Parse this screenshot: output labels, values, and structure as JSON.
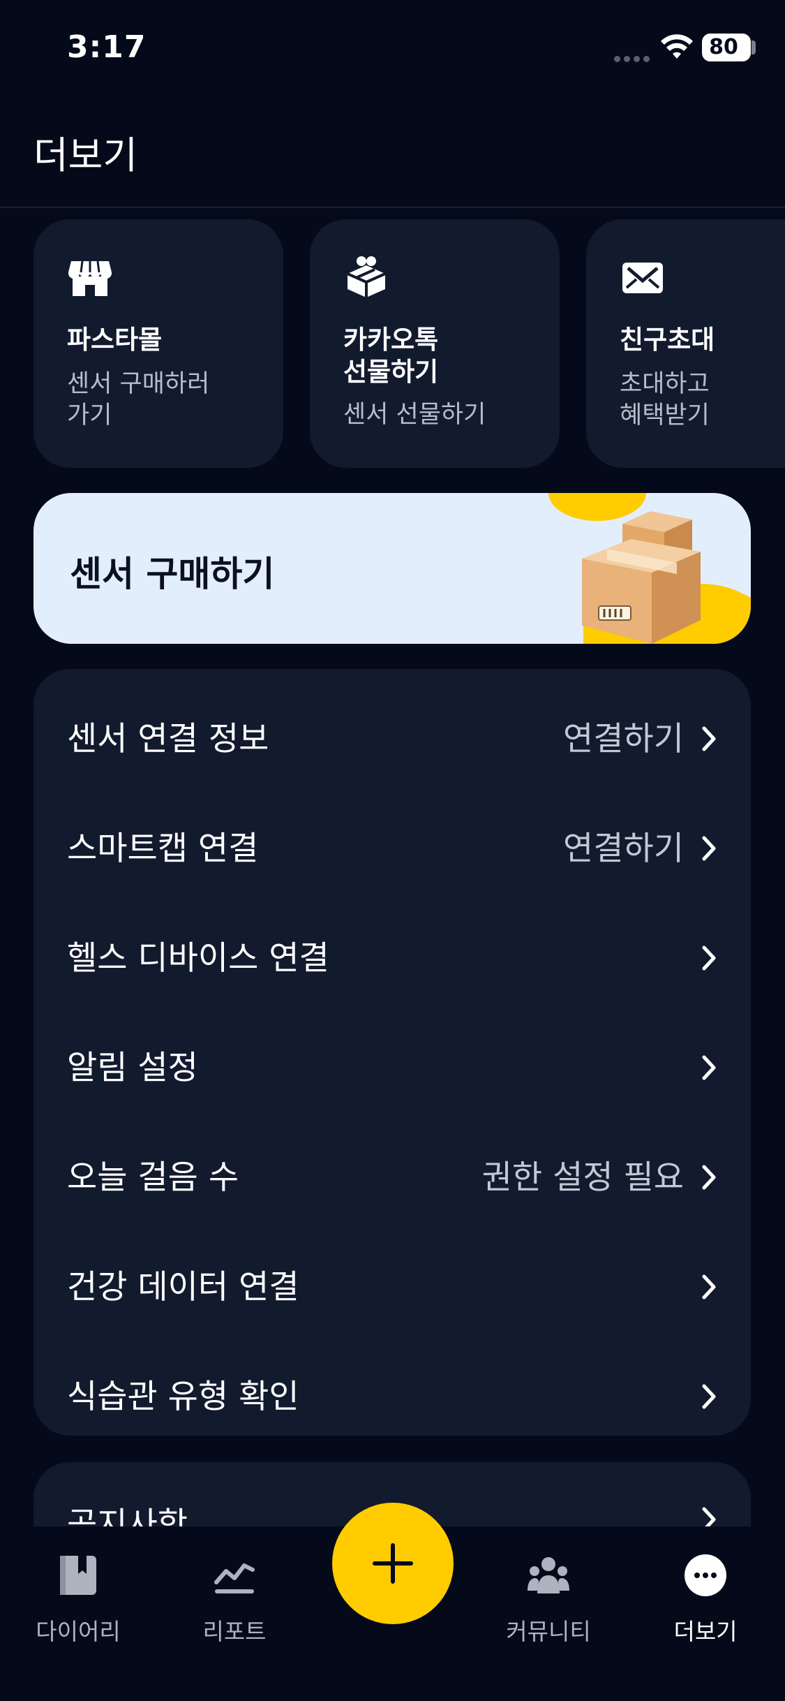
{
  "status_bar": {
    "time": "3:17",
    "battery": "80"
  },
  "header": {
    "title": "더보기"
  },
  "shortcuts": [
    {
      "title": "파스타몰",
      "subtitle": "센서 구매하러\n가기",
      "icon": "store-icon"
    },
    {
      "title": "카카오톡\n선물하기",
      "subtitle": "센서 선물하기",
      "icon": "gift-box-icon"
    },
    {
      "title": "친구초대",
      "subtitle": "초대하고\n혜택받기",
      "icon": "envelope-icon"
    }
  ],
  "banner": {
    "title": "센서 구매하기",
    "image": "cardboard-boxes-illustration"
  },
  "settings": {
    "items": [
      {
        "label": "센서 연결 정보",
        "value": "연결하기"
      },
      {
        "label": "스마트캡 연결",
        "value": "연결하기"
      },
      {
        "label": "헬스 디바이스 연결",
        "value": ""
      },
      {
        "label": "알림 설정",
        "value": ""
      },
      {
        "label": "오늘 걸음 수",
        "value": "권한 설정 필요"
      },
      {
        "label": "건강 데이터 연결",
        "value": ""
      },
      {
        "label": "식습관 유형 확인",
        "value": ""
      }
    ]
  },
  "notices": {
    "label": "공지사항"
  },
  "tab_bar": {
    "tabs": [
      {
        "label": "다이어리",
        "icon": "diary-icon"
      },
      {
        "label": "리포트",
        "icon": "chart-line-icon"
      },
      {
        "label": "커뮤니티",
        "icon": "community-icon"
      },
      {
        "label": "더보기",
        "icon": "more-dots-icon"
      }
    ],
    "active": "더보기",
    "fab_icon": "plus-icon"
  },
  "colors": {
    "background": "#050a1a",
    "card": "#121a2e",
    "accent": "#ffcc00",
    "banner": "#e3eefc"
  }
}
